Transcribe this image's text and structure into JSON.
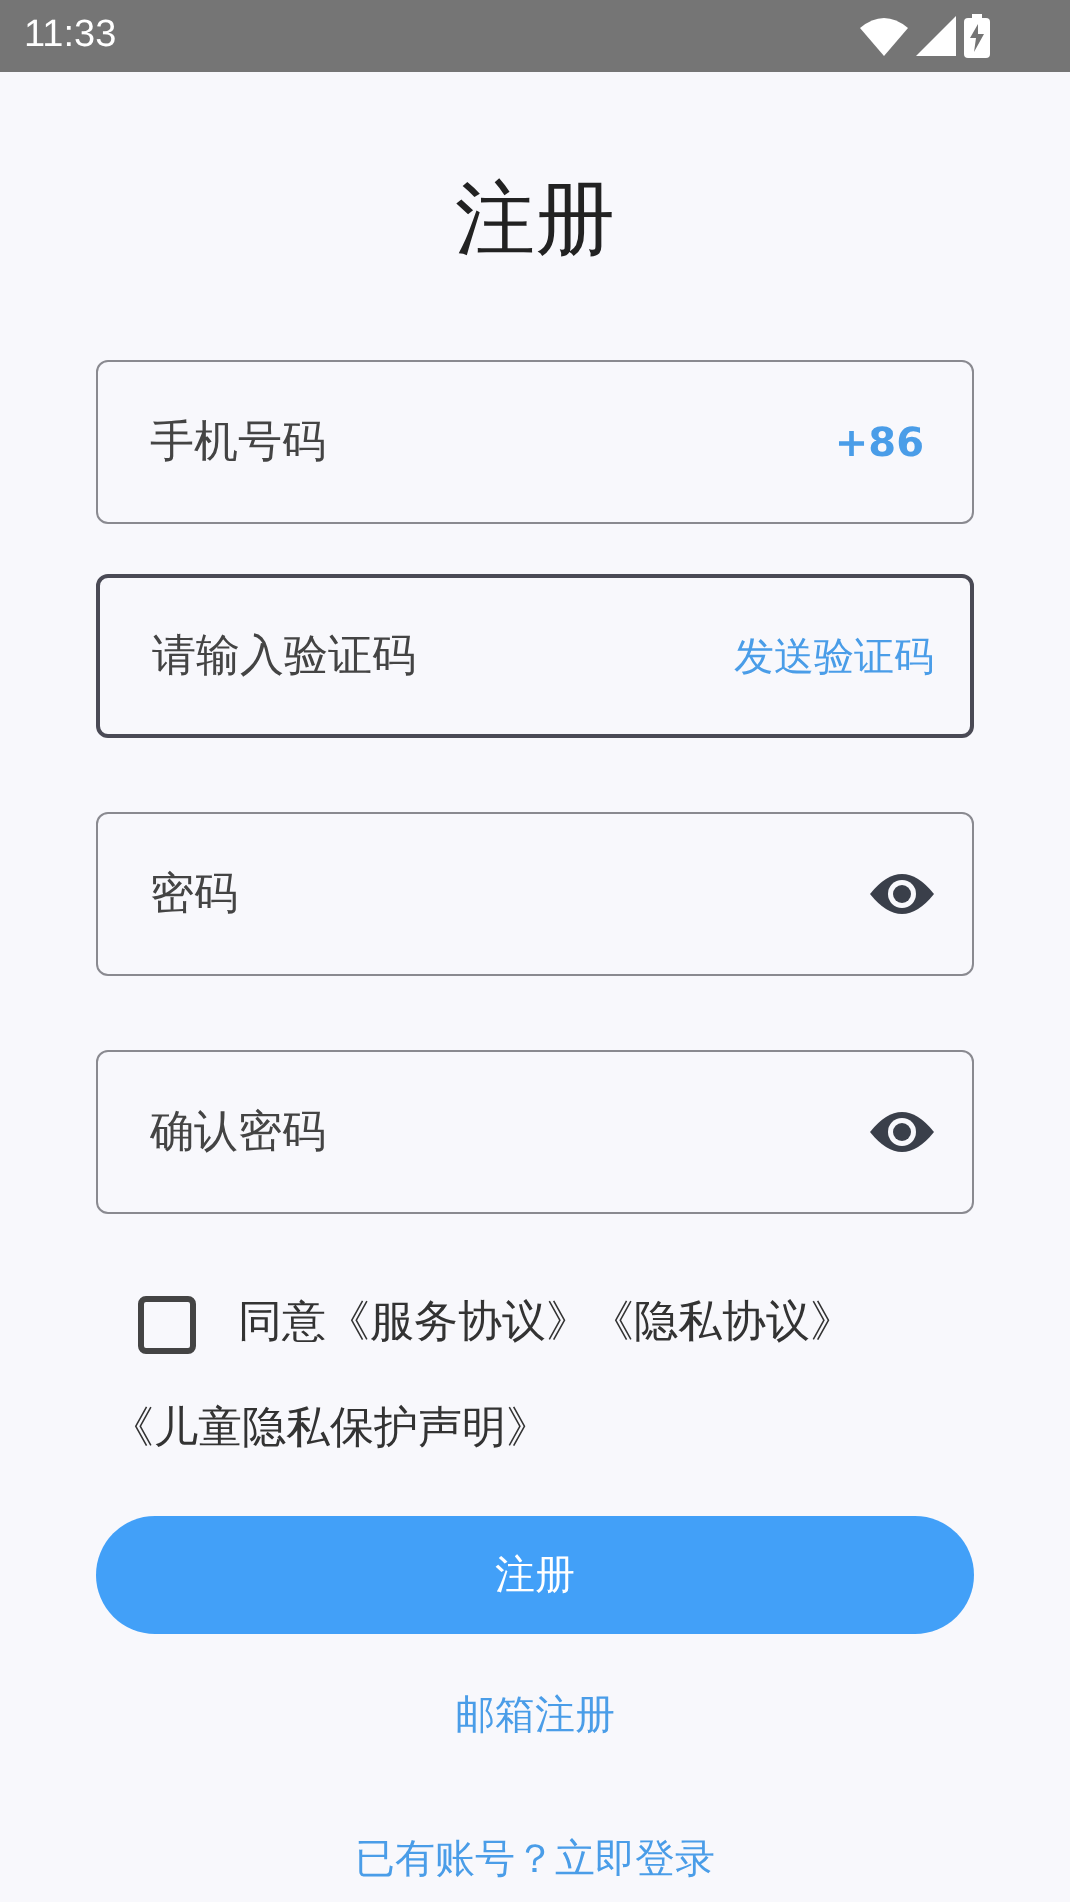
{
  "status_bar": {
    "time": "11:33"
  },
  "title": "注册",
  "fields": [
    {
      "kind": "country_code",
      "placeholder": "手机号码",
      "suffix": "+86",
      "focused": false
    },
    {
      "kind": "send_code",
      "placeholder": "请输入验证码",
      "suffix": "发送验证码",
      "focused": true
    },
    {
      "kind": "password",
      "placeholder": "密码",
      "focused": false
    },
    {
      "kind": "password",
      "placeholder": "确认密码",
      "focused": false
    }
  ],
  "agreement": {
    "checked": false,
    "text_lines": [
      "同意《服务协议》《隐私协议》",
      "《儿童隐私保护声明》"
    ]
  },
  "submit_button": "注册",
  "email_register_link": "邮箱注册",
  "login_link": "已有账号？立即登录"
}
